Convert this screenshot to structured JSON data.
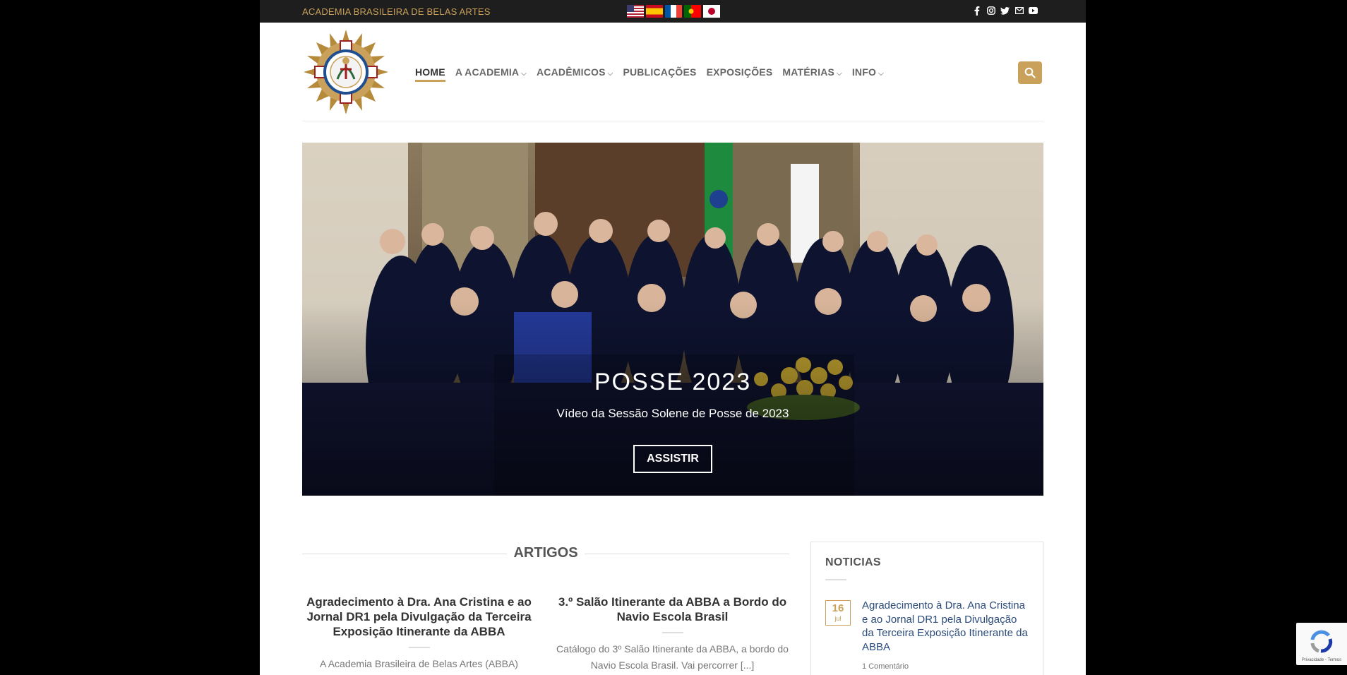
{
  "topbar": {
    "site_name": "ACADEMIA BRASILEIRA DE BELAS ARTES",
    "flags": [
      "us-flag",
      "es-flag",
      "fr-flag",
      "pt-flag",
      "jp-flag"
    ],
    "social": [
      "facebook-icon",
      "instagram-icon",
      "twitter-icon",
      "email-icon",
      "youtube-icon"
    ]
  },
  "nav": {
    "home": "HOME",
    "academia": "A ACADEMIA",
    "academicos": "ACADÊMICOS",
    "publicacoes": "PUBLICAÇÕES",
    "exposicoes": "EXPOSIÇÕES",
    "materias": "MATÉRIAS",
    "info": "INFO"
  },
  "hero": {
    "title": "POSSE 2023",
    "subtitle": "Vídeo da Sessão Solene de Posse de 2023",
    "button": "ASSISTIR"
  },
  "artigos": {
    "heading": "ARTIGOS",
    "items": [
      {
        "title": "Agradecimento à Dra. Ana Cristina e ao Jornal DR1 pela Divulgação da Terceira Exposição Itinerante da ABBA",
        "excerpt": "A Academia Brasileira de Belas Artes (ABBA)"
      },
      {
        "title": "3.º Salão Itinerante da ABBA a Bordo do Navio Escola Brasil",
        "excerpt": "Catálogo do 3º Salão Itinerante da ABBA, a bordo do Navio Escola Brasil. Vai percorrer [...]"
      }
    ]
  },
  "sidebar": {
    "heading": "NOTICIAS",
    "news": {
      "day": "16",
      "month": "jul",
      "title": "Agradecimento à Dra. Ana Cristina e ao Jornal DR1 pela Divulgação da Terceira Exposição Itinerante da ABBA",
      "comments": "1 Comentário"
    }
  },
  "recaptcha": {
    "label": "Privacidade - Termos"
  },
  "colors": {
    "accent": "#c9a15a",
    "topbar": "#1e1e1e",
    "link": "#2a4a7a"
  }
}
